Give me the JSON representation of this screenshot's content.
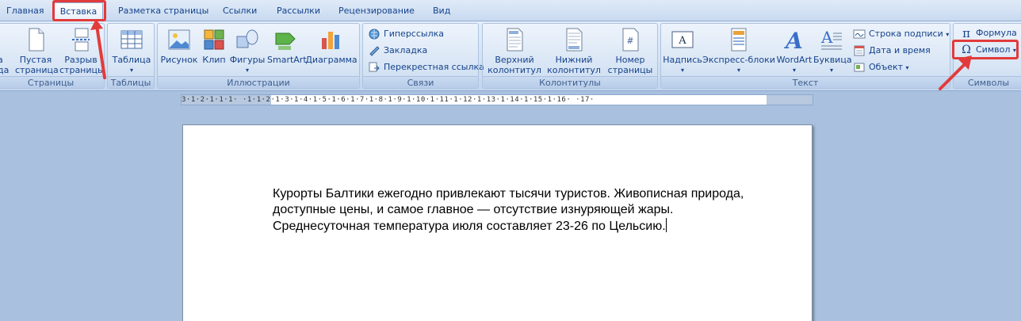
{
  "tabs": [
    {
      "label": "Главная",
      "active": false
    },
    {
      "label": "Вставка",
      "active": true
    },
    {
      "label": "Разметка страницы",
      "active": false
    },
    {
      "label": "Ссылки",
      "active": false
    },
    {
      "label": "Рассылки",
      "active": false
    },
    {
      "label": "Рецензирование",
      "active": false
    },
    {
      "label": "Вид",
      "active": false
    }
  ],
  "ribbon": {
    "pages": {
      "label": "Страницы",
      "cut_left": "а",
      "cut_left2": "да ▾",
      "blank_l1": "Пустая",
      "blank_l2": "страница",
      "break_l1": "Разрыв",
      "break_l2": "страницы"
    },
    "tables": {
      "label": "Таблицы",
      "table": "Таблица"
    },
    "illustrations": {
      "label": "Иллюстрации",
      "picture": "Рисунок",
      "clip": "Клип",
      "shapes": "Фигуры",
      "smartart": "SmartArt",
      "chart": "Диаграмма"
    },
    "links": {
      "label": "Связи",
      "hyperlink": "Гиперссылка",
      "bookmark": "Закладка",
      "crossref": "Перекрестная ссылка"
    },
    "headers": {
      "label": "Колонтитулы",
      "header_l1": "Верхний",
      "header_l2": "колонтитул",
      "footer_l1": "Нижний",
      "footer_l2": "колонтитул",
      "pagenum_l1": "Номер",
      "pagenum_l2": "страницы"
    },
    "text": {
      "label": "Текст",
      "textbox": "Надпись",
      "quickparts": "Экспресс-блоки",
      "wordart": "WordArt",
      "dropcap": "Буквица",
      "signature": "Строка подписи",
      "datetime": "Дата и время",
      "object": "Объект"
    },
    "symbols": {
      "label": "Символы",
      "formula": "Формула",
      "symbol": "Символ"
    }
  },
  "ruler": {
    "text": "3·1·2·1·1·1·  ·1·1·2·1·3·1·4·1·5·1·6·1·7·1·8·1·9·1·10·1·11·1·12·1·13·1·14·1·15·1·16· ·17·"
  },
  "document": {
    "text": "Курорты Балтики ежегодно привлекают тысячи туристов. Живописная природа, доступные цены, и самое главное — отсутствие изнуряющей жары. Среднесуточная температура июля составляет 23-26 по Цельсию."
  },
  "colors": {
    "highlight": "#e23b3b",
    "ribbon_text": "#15428b",
    "background": "#a9c1df"
  }
}
